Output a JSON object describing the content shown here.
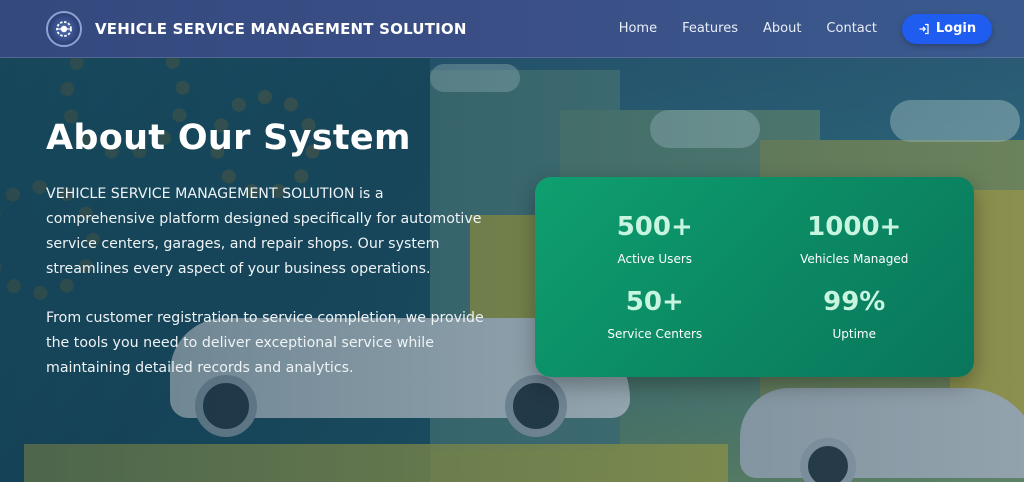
{
  "navbar": {
    "brand": "VEHICLE SERVICE MANAGEMENT SOLUTION",
    "links": [
      "Home",
      "Features",
      "About",
      "Contact"
    ],
    "login_label": "Login"
  },
  "hero": {
    "title": "About Our System",
    "paragraphs": [
      "VEHICLE SERVICE MANAGEMENT SOLUTION is a comprehensive platform designed specifically for automotive service centers, garages, and repair shops. Our system streamlines every aspect of your business operations.",
      "From customer registration to service completion, we provide the tools you need to deliver exceptional service while maintaining detailed records and analytics."
    ]
  },
  "stats": [
    {
      "value": "500+",
      "label": "Active Users"
    },
    {
      "value": "1000+",
      "label": "Vehicles Managed"
    },
    {
      "value": "50+",
      "label": "Service Centers"
    },
    {
      "value": "99%",
      "label": "Uptime"
    }
  ],
  "colors": {
    "navbar": "#3a4f86",
    "login_button": "#1f5cf0",
    "stats_card": "#0b8a64",
    "stat_value": "#c8f5e0"
  },
  "icons": {
    "logo": "vehicle-gear-logo-icon",
    "login": "login-icon"
  }
}
